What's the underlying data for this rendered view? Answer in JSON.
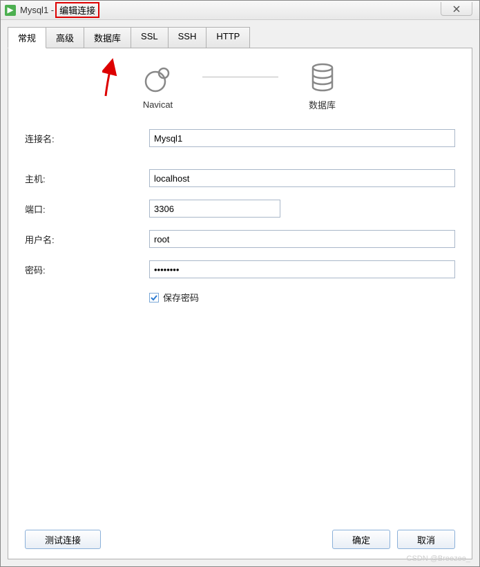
{
  "window": {
    "title_prefix": "Mysql1 -",
    "title_highlighted": "编辑连接"
  },
  "tabs": [
    {
      "label": "常规"
    },
    {
      "label": "高级"
    },
    {
      "label": "数据库"
    },
    {
      "label": "SSL"
    },
    {
      "label": "SSH"
    },
    {
      "label": "HТТР"
    }
  ],
  "tabs_fixed": {
    "t0": "常规",
    "t1": "高级",
    "t2": "数据库",
    "t3": "SSL",
    "t4": "SSH",
    "t5": "HTTP"
  },
  "diagram": {
    "left_label": "Navicat",
    "right_label": "数据库"
  },
  "form": {
    "connection_name_label": "连接名:",
    "connection_name_value": "Mysql1",
    "host_label": "主机:",
    "host_value": "localhost",
    "port_label": "端口:",
    "port_value": "3306",
    "user_label": "用户名:",
    "user_value": "root",
    "password_label": "密码:",
    "password_value": "••••••••",
    "save_password_label": "保存密码",
    "save_password_checked": true
  },
  "buttons": {
    "test_label": "测试连接",
    "ok_label": "确定",
    "cancel_label": "取消"
  },
  "watermark": "CSDN @Breezee_"
}
